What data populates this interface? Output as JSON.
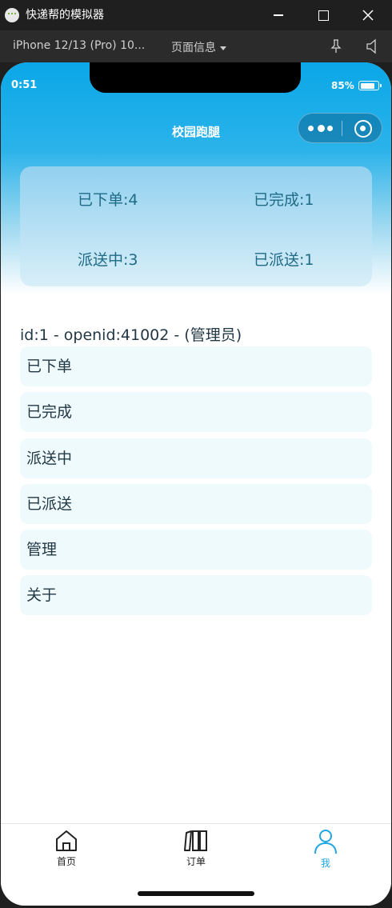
{
  "window": {
    "title": "快递帮的模拟器"
  },
  "toolbar": {
    "device": "iPhone 12/13 (Pro) 10...",
    "page_info": "页面信息"
  },
  "status_bar": {
    "time": "0:51",
    "battery": "85%"
  },
  "nav": {
    "title": "校园跑腿"
  },
  "stats": {
    "ordered": "已下单:4",
    "completed": "已完成:1",
    "delivering": "派送中:3",
    "delivered": "已派送:1"
  },
  "user": {
    "info": "id:1 - openid:41002 - (管理员)"
  },
  "menu": {
    "items": [
      {
        "label": "已下单"
      },
      {
        "label": "已完成"
      },
      {
        "label": "派送中"
      },
      {
        "label": "已派送"
      },
      {
        "label": "管理"
      },
      {
        "label": "关于"
      }
    ]
  },
  "tabbar": {
    "home": "首页",
    "orders": "订单",
    "me": "我",
    "active_color": "#21a6e0"
  },
  "colors": {
    "accent": "#0aa7e8"
  }
}
